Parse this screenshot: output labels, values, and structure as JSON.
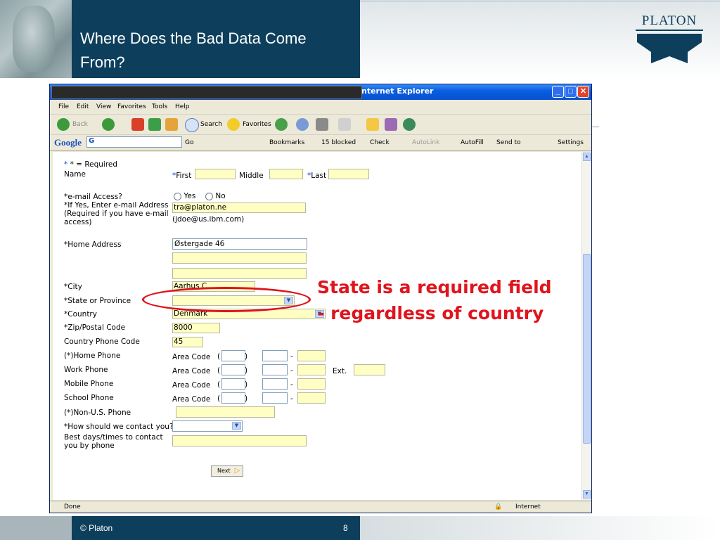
{
  "slide": {
    "title": "Where Does the Bad Data Come From?",
    "logo_text": "PLATON",
    "footer_copyright": "© Platon",
    "page_number": "8",
    "annotation_line1": "State is a required field",
    "annotation_line2": "- regardless of country",
    "accent_color": "#0d3f5c",
    "annotation_color": "#e0141c"
  },
  "browser": {
    "title": "nternet Explorer",
    "menu": [
      "File",
      "Edit",
      "View",
      "Favorites",
      "Tools",
      "Help"
    ],
    "toolbar": {
      "back": "Back",
      "search": "Search",
      "favorites": "Favorites"
    },
    "google_bar": {
      "logo": "Google",
      "g_button": "G",
      "go": "Go",
      "bookmarks": "Bookmarks",
      "blocked": "15 blocked",
      "check": "Check",
      "autolink": "AutoLink",
      "autofill": "AutoFill",
      "send_to": "Send to",
      "settings": "Settings"
    },
    "status": {
      "left": "Done",
      "zone": "Internet"
    }
  },
  "form": {
    "required_note": "* = Required",
    "name_label": "Name",
    "first_label": "First",
    "middle_label": "Middle",
    "last_label": "Last",
    "email_access_label": "*e-mail Access?",
    "yes_label": "Yes",
    "no_label": "No",
    "email_address_label1": "*If Yes, Enter e-mail Address",
    "email_address_label2": "(Required if you have e-mail",
    "email_address_label3": "access)",
    "email_value": "tra@platon.ne",
    "email_example": "(jdoe@us.ibm.com)",
    "home_address_label": "*Home Address",
    "home_address_value": "Østergade 46",
    "city_label": "*City",
    "city_value": "Aarhus C",
    "state_label": "*State or Province",
    "state_value": "",
    "country_label": "*Country",
    "country_value": "Denmark",
    "zip_label": "*Zip/Postal Code",
    "zip_value": "8000",
    "country_phone_label": "Country Phone Code",
    "country_phone_value": "45",
    "home_phone_label": "(*)Home Phone",
    "work_phone_label": "Work Phone",
    "mobile_phone_label": "Mobile Phone",
    "school_phone_label": "School Phone",
    "area_code_label": "Area Code",
    "ext_label": "Ext.",
    "non_us_phone_label": "(*)Non-U.S. Phone",
    "contact_label": "*How should we contact you?",
    "best_days_label1": "Best days/times to contact",
    "best_days_label2": "you by phone",
    "next_button": "Next"
  }
}
